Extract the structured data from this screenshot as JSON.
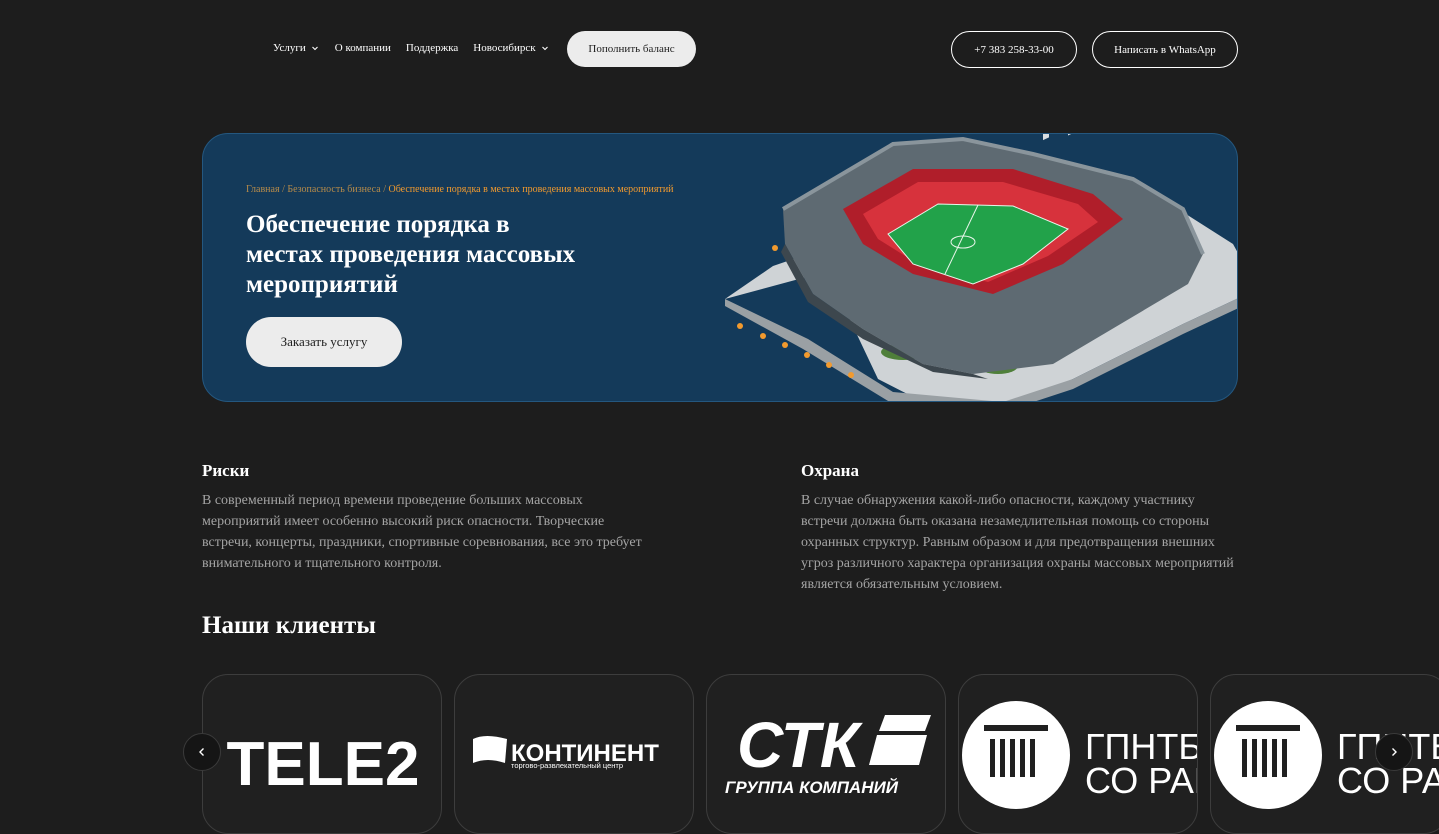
{
  "header": {
    "nav": [
      {
        "label": "Услуги",
        "has_dropdown": true
      },
      {
        "label": "О компании",
        "has_dropdown": false
      },
      {
        "label": "Поддержка",
        "has_dropdown": false
      },
      {
        "label": "Новосибирск",
        "has_dropdown": true
      }
    ],
    "balance_button": "Пополнить баланс",
    "phone_button": "+7 383 258-33-00",
    "whatsapp_button": "Написать в WhatsApp"
  },
  "hero": {
    "breadcrumb": {
      "home": "Главная",
      "section": "Безопасность бизнеса",
      "current": "Обеспечение порядка в местах проведения массовых мероприятий",
      "separator": " / "
    },
    "title": "Обеспечение порядка в местах проведения массовых мероприятий",
    "order_button": "Заказать услугу"
  },
  "risks": {
    "title": "Риски",
    "text": "В современный период времени проведение больших массовых мероприятий имеет особенно высокий риск опасности. Творческие встречи, концерты, праздники, спортивные соревнования, все это требует внимательного и тщательного контроля."
  },
  "guard": {
    "title": "Охрана",
    "text": "В случае обнаружения какой-либо опасности, каждому участнику встречи должна быть оказана незамедлительная помощь со стороны охранных структур. Равным образом и для предотвращения внешних угроз различного характера организация охраны массовых мероприятий является обязательным условием."
  },
  "clients": {
    "title": "Наши клиенты",
    "logos": [
      {
        "name": "tele2-logo",
        "text": "TELE2"
      },
      {
        "name": "kontinent-logo",
        "text": "КОНТИНЕНТ",
        "subtext": "торгово-развлекательный центр"
      },
      {
        "name": "stk-logo",
        "text": "СТК",
        "subtext": "ГРУППА КОМПАНИЙ"
      },
      {
        "name": "gpntb-logo",
        "text": "ГПНТБ",
        "subtext": "СО РАН"
      },
      {
        "name": "gpntb-logo-2",
        "text": "ГПНТБ",
        "subtext": "СО РАН"
      }
    ]
  },
  "colors": {
    "background": "#1d1d1d",
    "hero_background": "#143a5a",
    "accent_orange": "#f29a2e",
    "button_light": "#ececec",
    "muted_text": "#a4a4a4"
  }
}
